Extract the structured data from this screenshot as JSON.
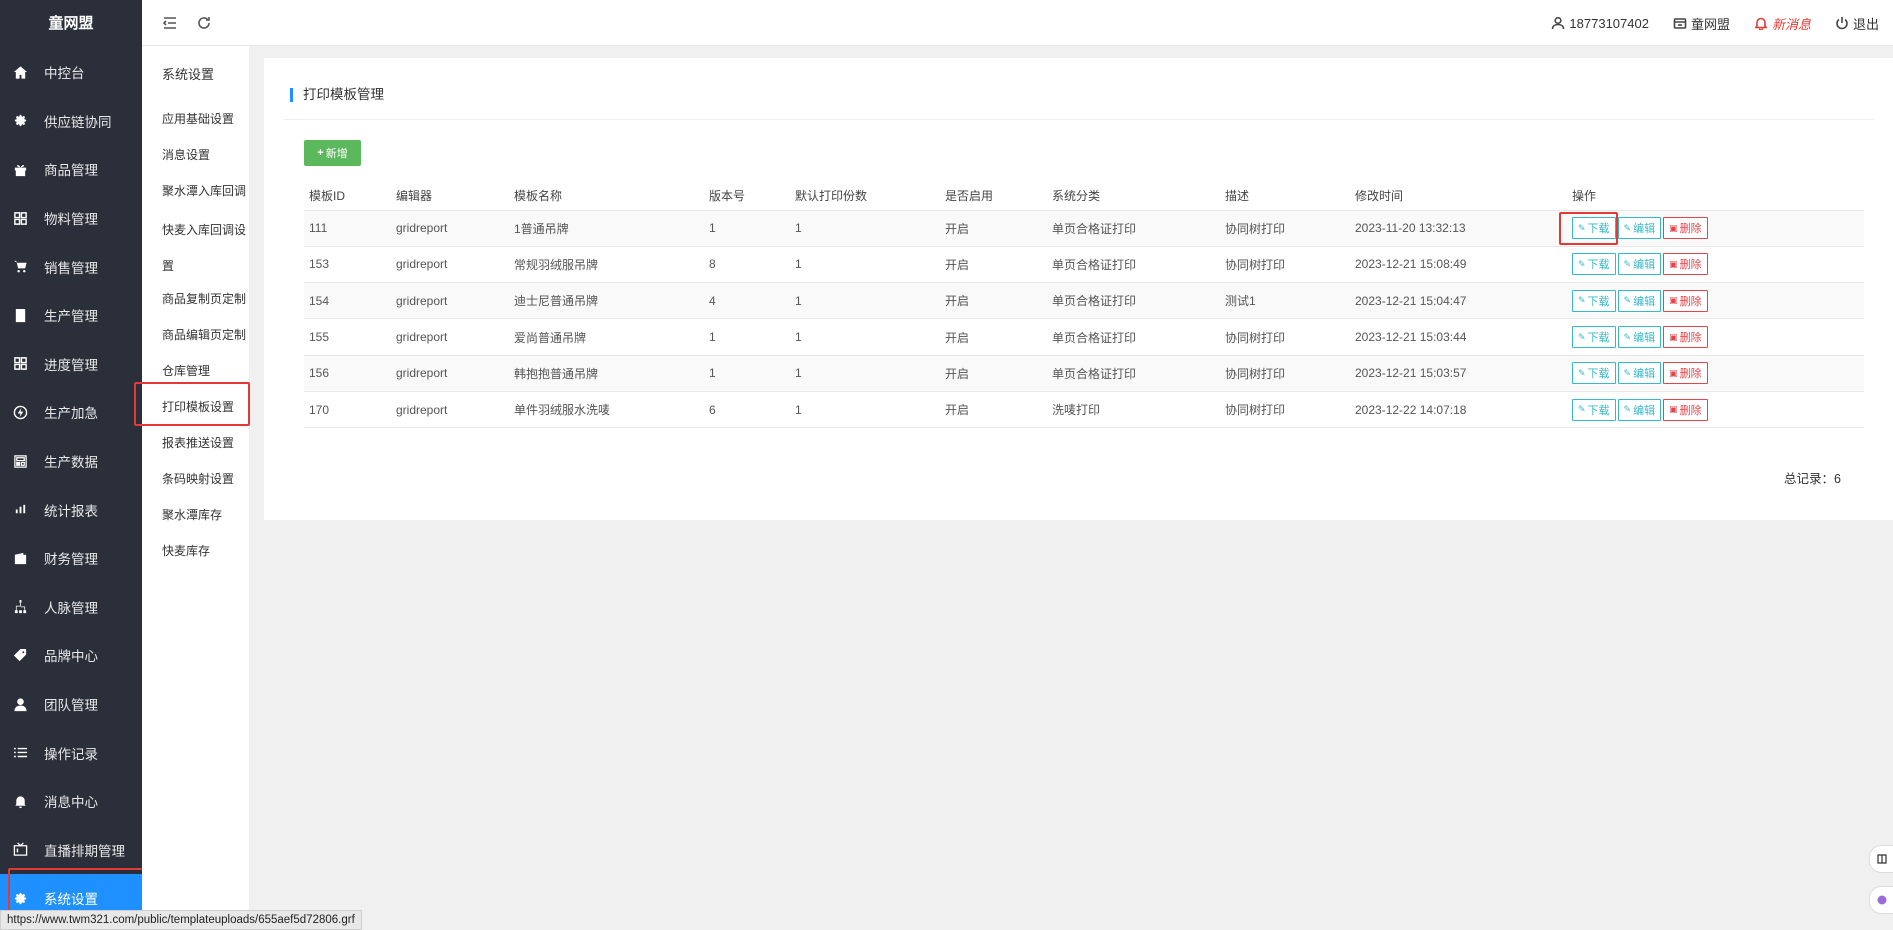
{
  "sidebar": {
    "brand": "童网盟",
    "items": [
      {
        "label": "中控台",
        "icon": "home-icon"
      },
      {
        "label": "供应链协同",
        "icon": "cog-icon"
      },
      {
        "label": "商品管理",
        "icon": "gift-icon"
      },
      {
        "label": "物料管理",
        "icon": "grid-icon"
      },
      {
        "label": "销售管理",
        "icon": "cart-icon"
      },
      {
        "label": "生产管理",
        "icon": "doc-icon"
      },
      {
        "label": "进度管理",
        "icon": "grid-icon"
      },
      {
        "label": "生产加急",
        "icon": "bolt-icon"
      },
      {
        "label": "生产数据",
        "icon": "news-icon"
      },
      {
        "label": "统计报表",
        "icon": "chart-icon"
      },
      {
        "label": "财务管理",
        "icon": "wallet-icon"
      },
      {
        "label": "人脉管理",
        "icon": "network-icon"
      },
      {
        "label": "品牌中心",
        "icon": "tag-icon"
      },
      {
        "label": "团队管理",
        "icon": "user-icon"
      },
      {
        "label": "操作记录",
        "icon": "list-icon"
      },
      {
        "label": "消息中心",
        "icon": "bell-icon"
      },
      {
        "label": "直播排期管理",
        "icon": "tv-icon"
      },
      {
        "label": "系统设置",
        "icon": "settings-icon"
      }
    ]
  },
  "submenu": {
    "title": "系统设置",
    "items": [
      "应用基础设置",
      "消息设置",
      "聚水潭入库回调",
      "快麦入库回调设置",
      "商品复制页定制",
      "商品编辑页定制",
      "仓库管理",
      "打印模板设置",
      "报表推送设置",
      "条码映射设置",
      "聚水潭库存",
      "快麦库存"
    ]
  },
  "topbar": {
    "phone": "18773107402",
    "org": "童网盟",
    "new_msg": "新消息",
    "logout": "退出"
  },
  "panel": {
    "title": "打印模板管理",
    "add_label": "新增",
    "columns": [
      "模板ID",
      "编辑器",
      "模板名称",
      "版本号",
      "默认打印份数",
      "是否启用",
      "系统分类",
      "描述",
      "修改时间",
      "操作"
    ],
    "rows": [
      [
        "111",
        "gridreport",
        "1普通吊牌",
        "1",
        "1",
        "开启",
        "单页合格证打印",
        "协同树打印",
        "2023-11-20 13:32:13"
      ],
      [
        "153",
        "gridreport",
        "常规羽绒服吊牌",
        "8",
        "1",
        "开启",
        "单页合格证打印",
        "协同树打印",
        "2023-12-21 15:08:49"
      ],
      [
        "154",
        "gridreport",
        "迪士尼普通吊牌",
        "4",
        "1",
        "开启",
        "单页合格证打印",
        "测试1",
        "2023-12-21 15:04:47"
      ],
      [
        "155",
        "gridreport",
        "爱尚普通吊牌",
        "1",
        "1",
        "开启",
        "单页合格证打印",
        "协同树打印",
        "2023-12-21 15:03:44"
      ],
      [
        "156",
        "gridreport",
        "韩抱抱普通吊牌",
        "1",
        "1",
        "开启",
        "单页合格证打印",
        "协同树打印",
        "2023-12-21 15:03:57"
      ],
      [
        "170",
        "gridreport",
        "单件羽绒服水洗唛",
        "6",
        "1",
        "开启",
        "洗唛打印",
        "协同树打印",
        "2023-12-22 14:07:18"
      ]
    ],
    "ops": {
      "download": "下载",
      "edit": "编辑",
      "delete": "删除"
    },
    "total": "总记录：6"
  },
  "status_url": "https://www.twm321.com/public/templateuploads/655aef5d72806.grf"
}
